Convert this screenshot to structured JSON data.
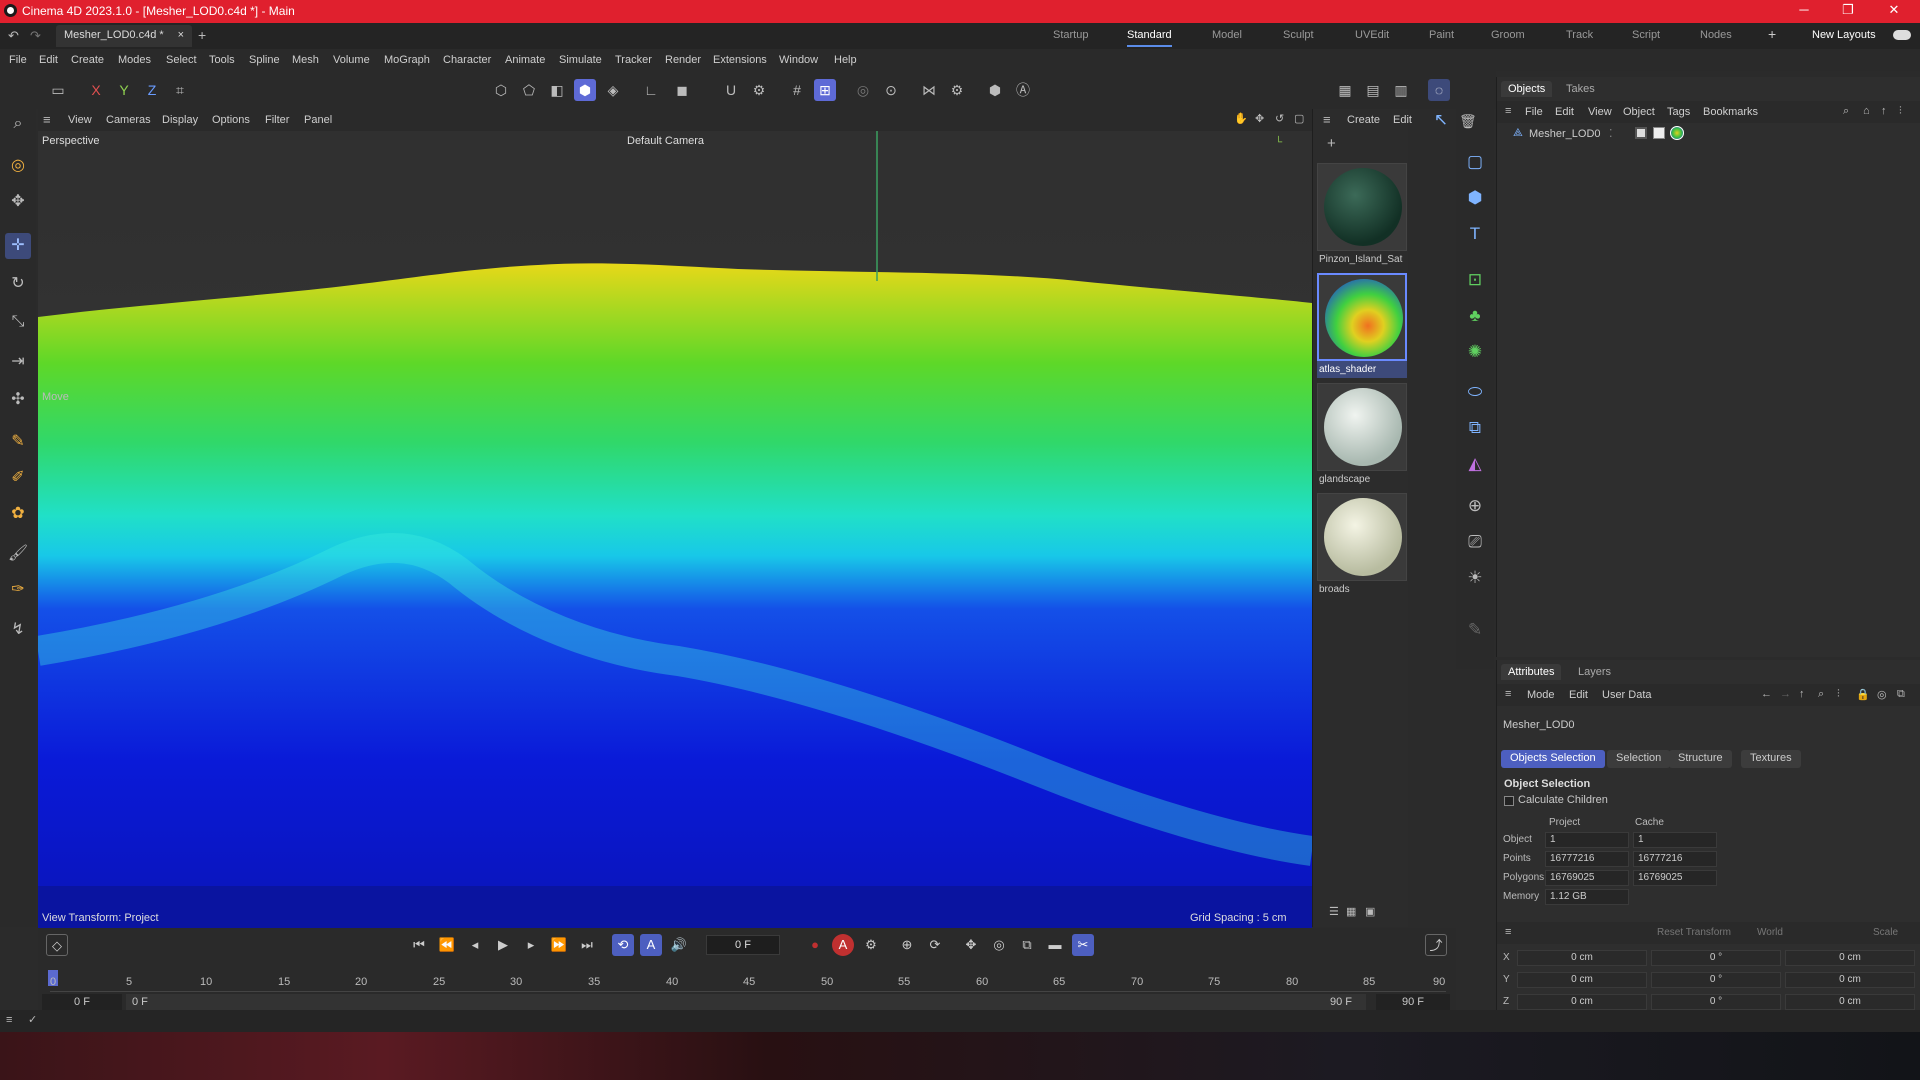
{
  "titlebar": {
    "title": "Cinema 4D 2023.1.0 - [Mesher_LOD0.c4d *] - Main"
  },
  "tabs": {
    "doc": "Mesher_LOD0.c4d *",
    "close": "×",
    "add": "+"
  },
  "layouts": [
    {
      "label": "Startup",
      "active": false
    },
    {
      "label": "Standard",
      "active": true
    },
    {
      "label": "Model",
      "active": false
    },
    {
      "label": "Sculpt",
      "active": false
    },
    {
      "label": "UVEdit",
      "active": false
    },
    {
      "label": "Paint",
      "active": false
    },
    {
      "label": "Groom",
      "active": false
    },
    {
      "label": "Track",
      "active": false
    },
    {
      "label": "Script",
      "active": false
    },
    {
      "label": "Nodes",
      "active": false
    }
  ],
  "new_layouts": "New Layouts",
  "menu": [
    "File",
    "Edit",
    "Create",
    "Modes",
    "Select",
    "Tools",
    "Spline",
    "Mesh",
    "Volume",
    "MoGraph",
    "Character",
    "Animate",
    "Simulate",
    "Tracker",
    "Render",
    "Extensions",
    "Window",
    "Help"
  ],
  "axes": {
    "x": "X",
    "y": "Y",
    "z": "Z"
  },
  "viewport": {
    "menu": [
      "View",
      "Cameras",
      "Display",
      "Options",
      "Filter",
      "Panel"
    ],
    "perspective": "Perspective",
    "camera": "Default Camera",
    "move": "Move",
    "view_transform": "View Transform: Project",
    "grid_spacing": "Grid Spacing : 5 cm"
  },
  "materials": {
    "menu": [
      "Create",
      "Edit"
    ],
    "items": [
      {
        "name": "Pinzon_Island_Sat",
        "selected": false
      },
      {
        "name": "atlas_shader",
        "selected": true
      },
      {
        "name": "glandscape",
        "selected": false
      },
      {
        "name": "broads",
        "selected": false
      }
    ]
  },
  "objects_panel": {
    "tabs": [
      "Objects",
      "Takes"
    ],
    "menu": [
      "File",
      "Edit",
      "View",
      "Object",
      "Tags",
      "Bookmarks"
    ],
    "object_name": "Mesher_LOD0"
  },
  "attributes": {
    "tabs": [
      "Attributes",
      "Layers"
    ],
    "menu": [
      "Mode",
      "Edit",
      "User Data"
    ],
    "object_name": "Mesher_LOD0",
    "subtabs": [
      {
        "label": "Objects Selection",
        "active": true
      },
      {
        "label": "Selection",
        "active": false
      },
      {
        "label": "Structure",
        "active": false
      },
      {
        "label": "Textures",
        "active": false
      }
    ],
    "section_title": "Object Selection",
    "calc_children": "Calculate Children",
    "col_project": "Project",
    "col_cache": "Cache",
    "rows": [
      {
        "label": "Object",
        "project": "1",
        "cache": "1"
      },
      {
        "label": "Points",
        "project": "16777216",
        "cache": "16777216"
      },
      {
        "label": "Polygons",
        "project": "16769025",
        "cache": "16769025"
      },
      {
        "label": "Memory",
        "project": "1.12 GB",
        "cache": ""
      }
    ]
  },
  "coords": {
    "reset": "Reset Transform",
    "world": "World",
    "scale": "Scale",
    "rows": [
      {
        "axis": "X",
        "pos": "0 cm",
        "rot": "0 °",
        "size": "0 cm"
      },
      {
        "axis": "Y",
        "pos": "0 cm",
        "rot": "0 °",
        "size": "0 cm"
      },
      {
        "axis": "Z",
        "pos": "0 cm",
        "rot": "0 °",
        "size": "0 cm"
      }
    ]
  },
  "timeline": {
    "current_frame": "0 F",
    "start": "0 F",
    "start2": "0 F",
    "end": "90 F",
    "end2": "90 F",
    "ticks": [
      "0",
      "5",
      "10",
      "15",
      "20",
      "25",
      "30",
      "35",
      "40",
      "45",
      "50",
      "55",
      "60",
      "65",
      "70",
      "75",
      "80",
      "85",
      "90"
    ]
  },
  "colors": {
    "titlebar": "#e0202e",
    "accent": "#5b8ce8",
    "selected": "#4d5fc0"
  }
}
